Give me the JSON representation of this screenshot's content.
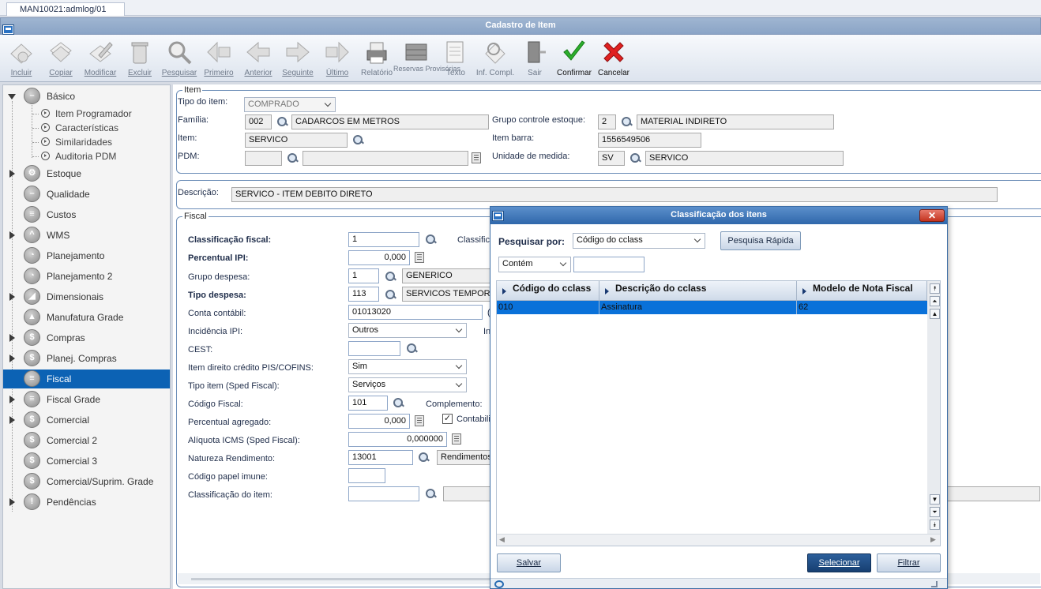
{
  "tab": {
    "label": "MAN10021:admlog/01"
  },
  "window": {
    "title": "Cadastro de Item"
  },
  "toolbar": {
    "items": [
      {
        "label": "Incluir",
        "icon": "add-icon"
      },
      {
        "label": "Copiar",
        "icon": "copy-icon"
      },
      {
        "label": "Modificar",
        "icon": "edit-icon"
      },
      {
        "label": "Excluir",
        "icon": "trash-icon"
      },
      {
        "label": "Pesquisar",
        "icon": "search-icon"
      },
      {
        "label": "Primeiro",
        "icon": "first-icon"
      },
      {
        "label": "Anterior",
        "icon": "previous-icon"
      },
      {
        "label": "Seguinte",
        "icon": "next-icon"
      },
      {
        "label": "Último",
        "icon": "last-icon"
      },
      {
        "label": "Relatório",
        "icon": "printer-icon"
      },
      {
        "label": "Reservas Provisórias",
        "icon": "reserve-icon"
      },
      {
        "label": "Texto",
        "icon": "text-icon"
      },
      {
        "label": "Inf. Compl.",
        "icon": "info-icon"
      },
      {
        "label": "Sair",
        "icon": "exit-icon"
      },
      {
        "label": "Confirmar",
        "icon": "check-icon"
      },
      {
        "label": "Cancelar",
        "icon": "cancel-icon"
      }
    ]
  },
  "tree": {
    "basico": "Básico",
    "children": [
      "Item Programador",
      "Características",
      "Similaridades",
      "Auditoria PDM"
    ],
    "nodes": [
      "Estoque",
      "Qualidade",
      "Custos",
      "WMS",
      "Planejamento",
      "Planejamento 2",
      "Dimensionais",
      "Manufatura Grade",
      "Compras",
      "Planej. Compras",
      "Fiscal",
      "Fiscal Grade",
      "Comercial",
      "Comercial 2",
      "Comercial 3",
      "Comercial/Suprim. Grade",
      "Pendências"
    ]
  },
  "item": {
    "legend": "Item",
    "tipo_label": "Tipo do item:",
    "tipo_value": "COMPRADO",
    "familia_label": "Família:",
    "familia_code": "002",
    "familia_desc": "CADARCOS EM METROS",
    "grupo_label": "Grupo controle estoque:",
    "grupo_code": "2",
    "grupo_desc": "MATERIAL INDIRETO",
    "item_label": "Item:",
    "item_value": "SERVICO",
    "barra_label": "Item barra:",
    "barra_value": "1556549506",
    "pdm_label": "PDM:",
    "unidade_label": "Unidade de medida:",
    "unidade_code": "SV",
    "unidade_desc": "SERVICO"
  },
  "descricao": {
    "label": "Descrição:",
    "value": "SERVICO - ITEM DEBITO DIRETO"
  },
  "fiscal": {
    "legend": "Fiscal",
    "class_label": "Classificação fiscal:",
    "class_value": "1",
    "class_right": "Classific",
    "ipi_label": "Percentual IPI:",
    "ipi_value": "0,000",
    "gdesp_label": "Grupo despesa:",
    "gdesp_code": "1",
    "gdesp_desc": "GENERICO",
    "tdesp_label": "Tipo despesa:",
    "tdesp_code": "113",
    "tdesp_desc": "SERVICOS TEMPORAI",
    "conta_label": "Conta contábil:",
    "conta_value": "01013020",
    "conta_right": "(",
    "incid_label": "Incidência IPI:",
    "incid_value": "Outros",
    "incid_right": "In",
    "cest_label": "CEST:",
    "pis_label": "Item direito crédito PIS/COFINS:",
    "pis_value": "Sim",
    "sped_label": "Tipo item (Sped Fiscal):",
    "sped_value": "Serviços",
    "codfis_label": "Código Fiscal:",
    "codfis_value": "101",
    "compl_label": "Complemento:",
    "pagreg_label": "Percentual agregado:",
    "pagreg_value": "0,000",
    "contab_label": "Contabili",
    "icms_label": "Alíquota ICMS (Sped Fiscal):",
    "icms_value": "0,000000",
    "natrend_label": "Natureza Rendimento:",
    "natrend_code": "13001",
    "natrend_desc": "Rendimentos",
    "papel_label": "Código papel imune:",
    "classitem_label": "Classificação do item:"
  },
  "dialog": {
    "title": "Classificação dos itens",
    "search_label": "Pesquisar por:",
    "search_field": "Código do cclass",
    "quick_button": "Pesquisa Rápida",
    "match_mode": "Contém",
    "columns": [
      "Código do cclass",
      "Descrição do cclass",
      "Modelo de Nota Fiscal"
    ],
    "rows": [
      [
        "010",
        "Assinatura",
        "62"
      ]
    ],
    "save_button": "Salvar",
    "select_button": "Selecionar",
    "filter_button": "Filtrar"
  }
}
